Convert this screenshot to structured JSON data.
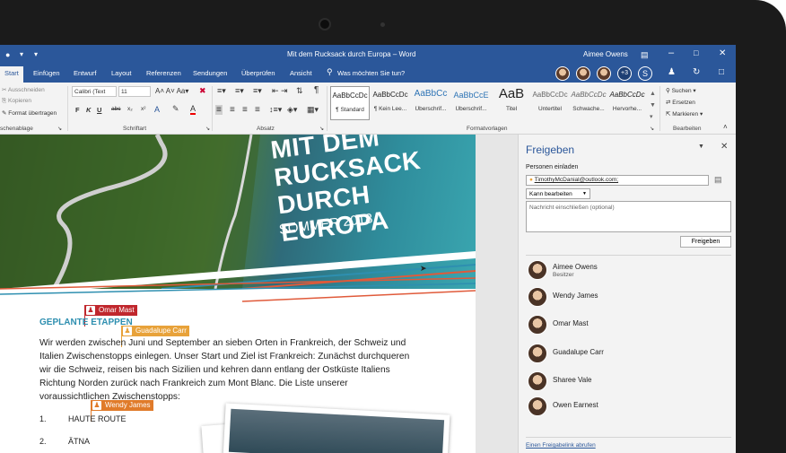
{
  "titlebar": {
    "doc_title": "Mit dem Rucksack durch Europa – Word",
    "user_name": "Aimee Owens",
    "quick_access": [
      "save-icon",
      "undo-icon",
      "customize-icon"
    ]
  },
  "tabs": [
    "Start",
    "Einfügen",
    "Entwurf",
    "Layout",
    "Referenzen",
    "Sendungen",
    "Überprüfen",
    "Ansicht"
  ],
  "tell_me": "Was möchten Sie tun?",
  "collab": {
    "extra_count": "+3"
  },
  "ribbon": {
    "clipboard": {
      "cut": "Ausschneiden",
      "copy": "Kopieren",
      "format_painter": "Format übertragen",
      "group": "schenablage"
    },
    "font": {
      "font_name": "Calibri (Text",
      "font_size": "11",
      "bold": "F",
      "italic": "K",
      "underline": "U",
      "strike": "abc",
      "sub": "x₂",
      "sup": "x²",
      "group": "Schriftart"
    },
    "paragraph": {
      "group": "Absatz",
      "pilcrow": "¶"
    },
    "styles": {
      "group": "Formatvorlagen",
      "items": [
        {
          "preview": "AaBbCcDc",
          "label": "¶ Standard"
        },
        {
          "preview": "AaBbCcDc",
          "label": "¶ Kein Lee..."
        },
        {
          "preview": "AaBbCc",
          "label": "Überschrif..."
        },
        {
          "preview": "AaBbCcE",
          "label": "Überschrif..."
        },
        {
          "preview": "AaB",
          "label": "Titel"
        },
        {
          "preview": "AaBbCcDc",
          "label": "Untertitel"
        },
        {
          "preview": "AaBbCcDc",
          "label": "Schwache..."
        },
        {
          "preview": "AaBbCcDc",
          "label": "Hervorhe..."
        }
      ]
    },
    "editing": {
      "find": "Suchen",
      "replace": "Ersetzen",
      "select": "Markieren",
      "group": "Bearbeiten"
    }
  },
  "document": {
    "hero_title_lines": [
      "MIT DEM",
      "RUCKSACK",
      "DURCH EUROPA"
    ],
    "hero_subtitle": "SOMMER 2018",
    "heading": "GEPLANTE ETAPPEN",
    "body": "Wir werden zwischen Juni und September an sieben Orten in Frankreich, der Schweiz und Italien Zwischenstopps einlegen. Unser Start und Ziel ist Frankreich: Zunächst durchqueren wir die Schweiz, reisen bis nach Sizilien und kehren dann entlang der Ostküste Italiens Richtung Norden zurück nach Frankreich zum Mont Blanc. Die Liste unserer voraussichtlichen Zwischenstopps:",
    "list": [
      {
        "num": "1.",
        "text": "HAUTE ROUTE"
      },
      {
        "num": "2.",
        "text": "ÄTNA"
      }
    ],
    "coauthors": [
      {
        "name": "Omar Mast",
        "color": "#c0272d"
      },
      {
        "name": "Guadalupe Carr",
        "color": "#e8a23a"
      },
      {
        "name": "Wendy James",
        "color": "#e07b2a"
      }
    ]
  },
  "share_pane": {
    "title": "Freigeben",
    "invite_label": "Personen einladen",
    "invite_value": "TimothyMcDanial@outlook.com;",
    "permission": "Kann bearbeiten",
    "message_placeholder": "Nachricht einschließen (optional)",
    "share_button": "Freigeben",
    "people": [
      {
        "name": "Aimee Owens",
        "role": "Besitzer"
      },
      {
        "name": "Wendy James",
        "role": ""
      },
      {
        "name": "Omar Mast",
        "role": ""
      },
      {
        "name": "Guadalupe Carr",
        "role": ""
      },
      {
        "name": "Sharee Vale",
        "role": ""
      },
      {
        "name": "Owen Earnest",
        "role": ""
      }
    ],
    "share_link": "Einen Freigabelink abrufen"
  },
  "colors": {
    "word_blue": "#2b579a",
    "accent_teal": "#2e8fb0"
  }
}
